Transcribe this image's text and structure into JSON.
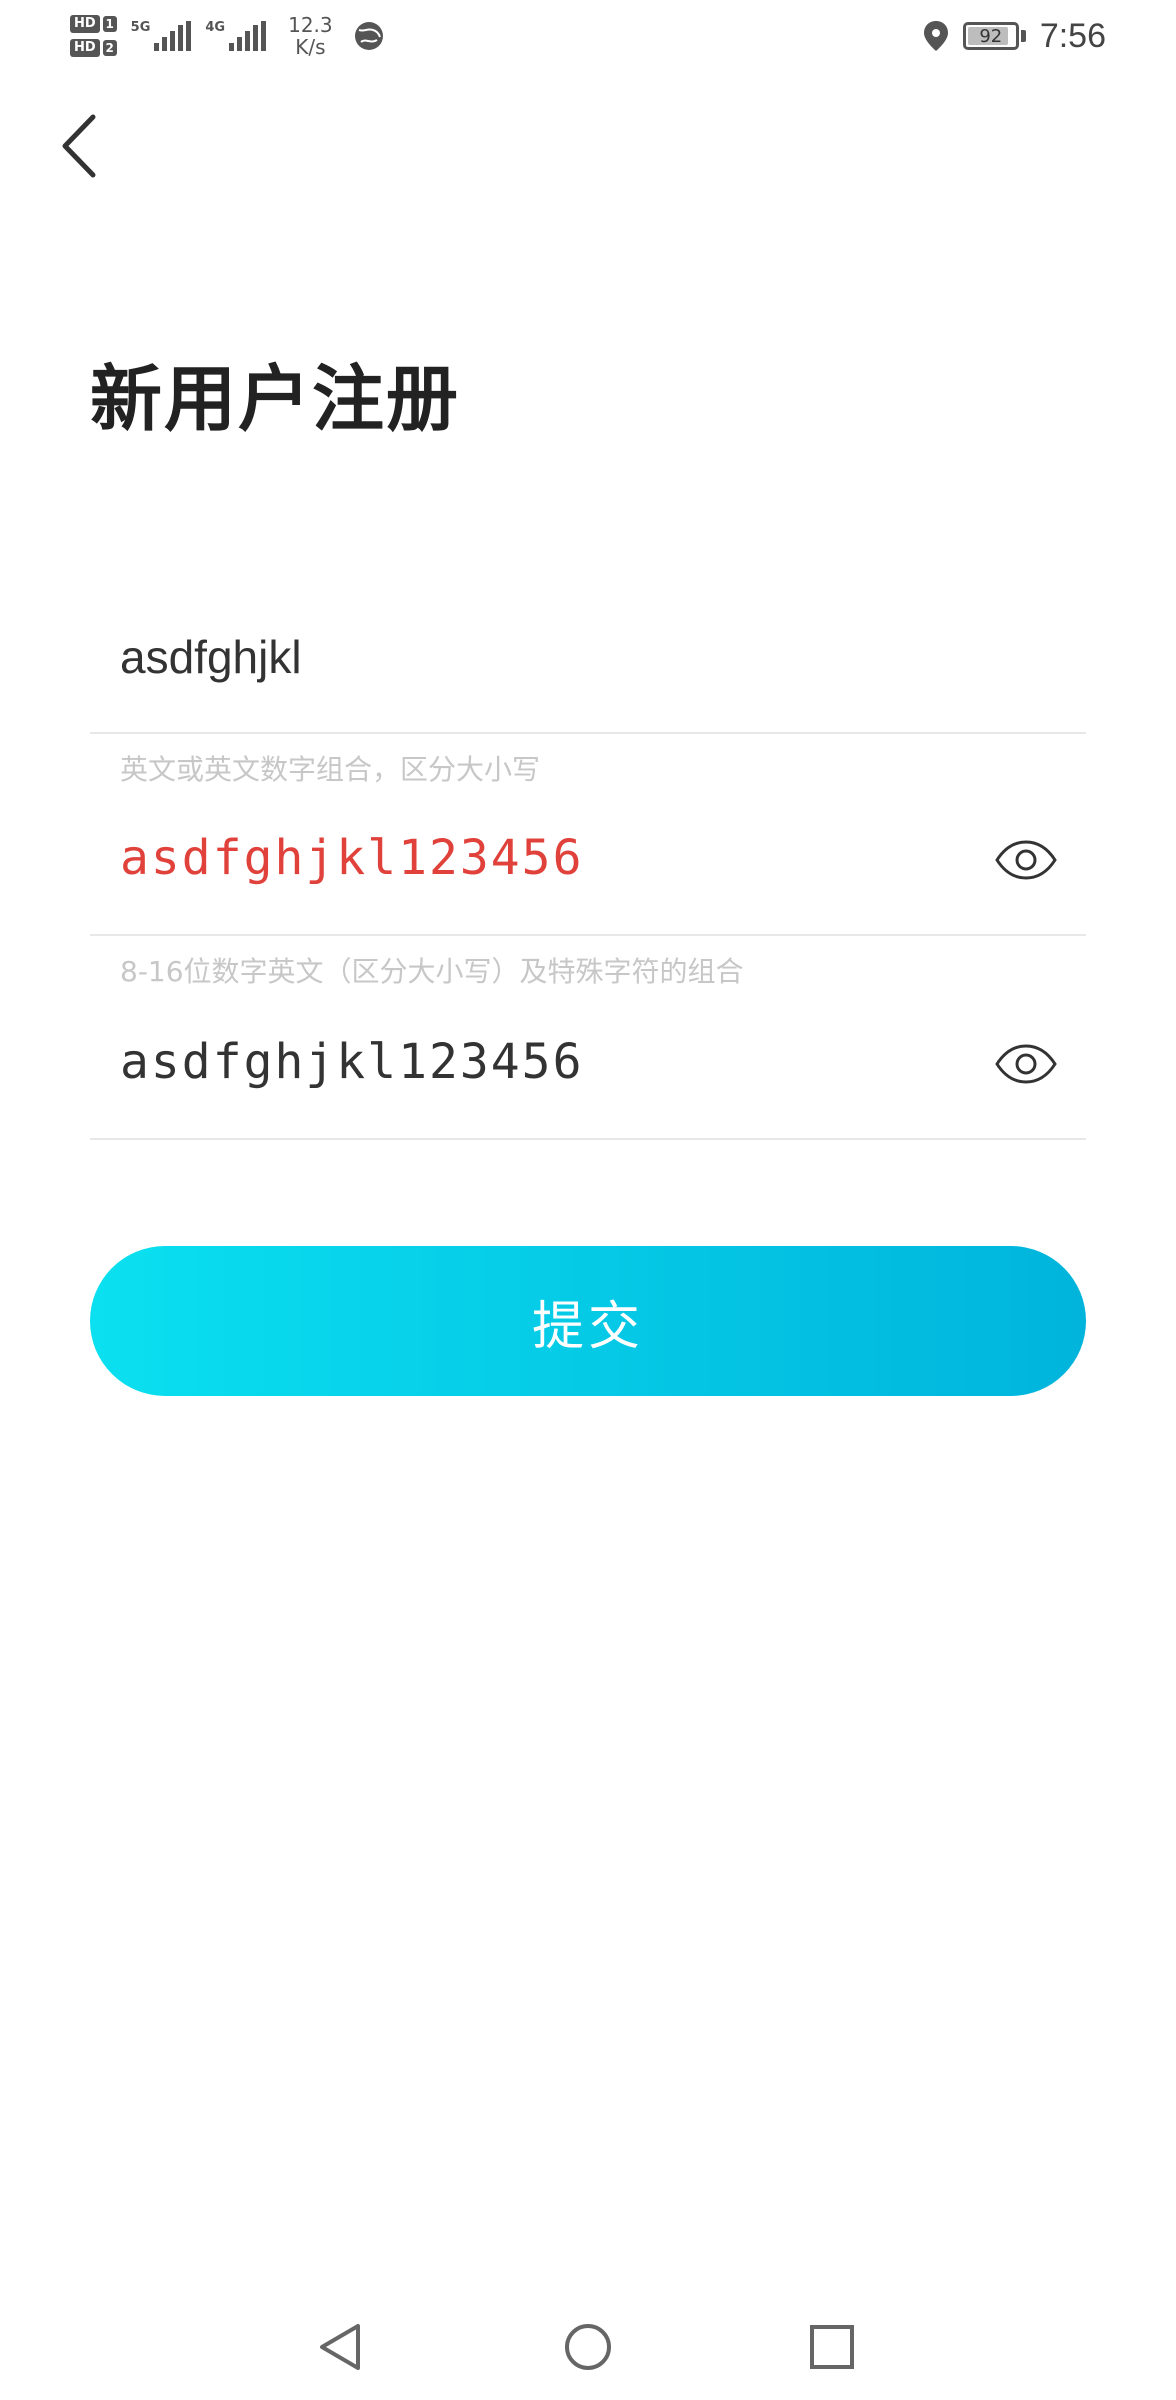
{
  "status_bar": {
    "sim1_label": "HD",
    "sim1_num": "1",
    "sim2_label": "HD",
    "sim2_num": "2",
    "network1": "5G",
    "network2": "4G",
    "speed_value": "12.3",
    "speed_unit": "K/s",
    "battery_level": 92,
    "battery_text": "92",
    "time": "7:56",
    "icons": [
      "sim-hd-icon",
      "signal-icon",
      "globe-icon",
      "location-icon",
      "battery-icon"
    ]
  },
  "header": {
    "back_icon": "back-arrow-icon",
    "title": "新用户注册"
  },
  "form": {
    "username_value": "asdfghjkl",
    "username_hint": "英文或英文数字组合，区分大小写",
    "password_value": "asdfghjkl123456",
    "password_color": "#e0413b",
    "password_hint": "8-16位数字英文（区分大小写）及特殊字符的组合",
    "confirm_value": "asdfghjkl123456",
    "confirm_color": "#333333",
    "visibility_icon": "eye-icon"
  },
  "submit": {
    "label": "提交",
    "gradient_start": "#0ae0f0",
    "gradient_end": "#00b4dc"
  },
  "nav_bar": {
    "icons": [
      "nav-back-icon",
      "nav-home-icon",
      "nav-recents-icon"
    ]
  }
}
